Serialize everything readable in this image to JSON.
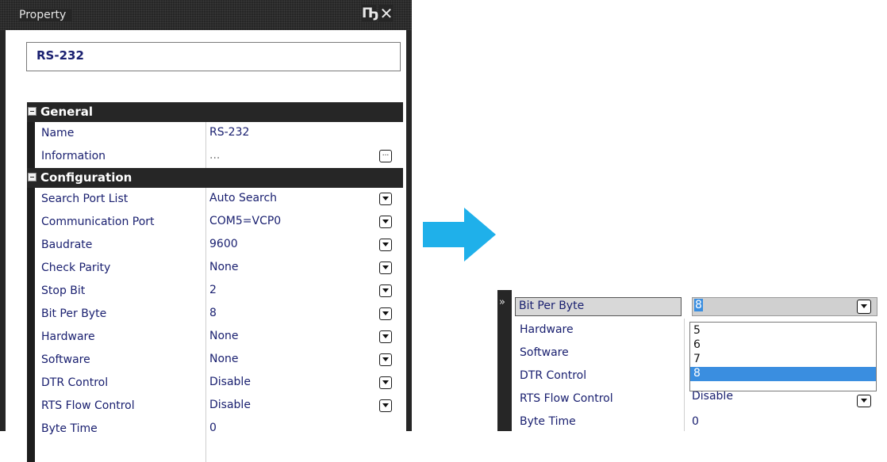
{
  "panel": {
    "title": "Property",
    "pin_glyph": "1",
    "close_glyph": "✕",
    "object_name": "RS-232"
  },
  "categories": {
    "general": "General",
    "configuration": "Configuration"
  },
  "general_props": [
    {
      "name": "Name",
      "value": "RS-232"
    },
    {
      "name": "Information",
      "value": "..."
    }
  ],
  "config_props": [
    {
      "name": "Search Port List",
      "value": "Auto Search"
    },
    {
      "name": "Communication Port",
      "value": "COM5=VCP0"
    },
    {
      "name": "Baudrate",
      "value": "9600"
    },
    {
      "name": "Check Parity",
      "value": "None"
    },
    {
      "name": "Stop Bit",
      "value": "2"
    },
    {
      "name": "Bit Per Byte",
      "value": "8"
    },
    {
      "name": "Hardware",
      "value": "None"
    },
    {
      "name": "Software",
      "value": "None"
    },
    {
      "name": "DTR Control",
      "value": "Disable"
    },
    {
      "name": "RTS Flow Control",
      "value": "Disable"
    },
    {
      "name": "Byte Time",
      "value": "0"
    }
  ],
  "zoom": {
    "selected_name": "Bit Per Byte",
    "selected_value": "8",
    "rows": [
      "Hardware",
      "Software",
      "DTR Control",
      "RTS Flow Control",
      "Byte Time"
    ],
    "partial_value": "Disable",
    "byte_time_value": "0",
    "options": [
      "5",
      "6",
      "7",
      "8"
    ],
    "selected_option": "8"
  },
  "colors": {
    "dark_panel": "#262626",
    "text_blue": "#1a2070",
    "arrow": "#1fb0ea",
    "highlight": "#3a8ee0"
  },
  "icons": [
    "pin-icon",
    "close-icon",
    "expand-icon",
    "dropdown-icon",
    "ellipsis-icon",
    "chevron-right-icon",
    "arrow-right-icon"
  ]
}
